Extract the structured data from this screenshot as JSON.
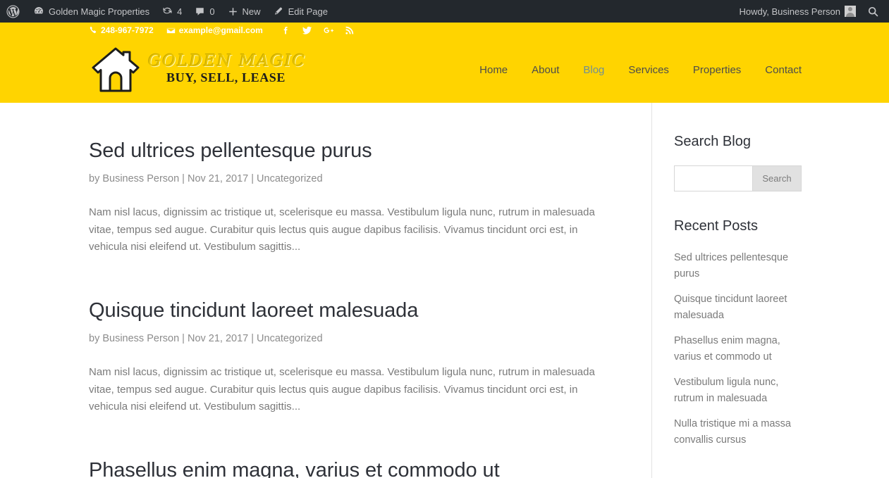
{
  "adminbar": {
    "logo_icon": "wordpress-icon",
    "site_name": "Golden Magic Properties",
    "site_icon": "dashboard-icon",
    "updates_icon": "updates-icon",
    "updates_count": "4",
    "comments_icon": "comment-icon",
    "comments_count": "0",
    "new_icon": "plus-icon",
    "new_label": "New",
    "edit_icon": "pencil-icon",
    "edit_label": "Edit Page",
    "howdy": "Howdy, Business Person",
    "avatar_icon": "avatar",
    "search_icon": "search-icon",
    "bg_color": "#23282d"
  },
  "header": {
    "bg_color": "#ffd400",
    "phone_icon": "phone-icon",
    "phone": "248-967-7972",
    "email_icon": "envelope-icon",
    "email": "example@gmail.com",
    "social": [
      {
        "name": "facebook-icon",
        "glyph": "f"
      },
      {
        "name": "twitter-icon",
        "glyph": ""
      },
      {
        "name": "googleplus-icon",
        "glyph": "G+"
      },
      {
        "name": "rss-icon",
        "glyph": ""
      }
    ],
    "logo": {
      "icon": "house-logo-icon",
      "name": "GOLDEN MAGIC",
      "tagline": "BUY, SELL, LEASE"
    },
    "nav": [
      {
        "label": "Home",
        "active": false
      },
      {
        "label": "About",
        "active": false
      },
      {
        "label": "Blog",
        "active": true
      },
      {
        "label": "Services",
        "active": false
      },
      {
        "label": "Properties",
        "active": false
      },
      {
        "label": "Contact",
        "active": false
      }
    ],
    "active_nav_color": "#6f8f96"
  },
  "main": {
    "posts": [
      {
        "title": "Sed ultrices pellentesque purus",
        "author_prefix": "by",
        "author": "Business Person",
        "date": "Nov 21, 2017",
        "category": "Uncategorized",
        "meta": "by Business Person | Nov 21, 2017 | Uncategorized",
        "excerpt": "Nam nisl lacus, dignissim ac tristique ut, scelerisque eu massa. Vestibulum ligula nunc, rutrum in malesuada vitae, tempus sed augue. Curabitur quis lectus quis augue dapibus facilisis. Vivamus tincidunt orci est, in vehicula nisi eleifend ut. Vestibulum sagittis..."
      },
      {
        "title": "Quisque tincidunt laoreet malesuada",
        "author_prefix": "by",
        "author": "Business Person",
        "date": "Nov 21, 2017",
        "category": "Uncategorized",
        "meta": "by Business Person | Nov 21, 2017 | Uncategorized",
        "excerpt": "Nam nisl lacus, dignissim ac tristique ut, scelerisque eu massa. Vestibulum ligula nunc, rutrum in malesuada vitae, tempus sed augue. Curabitur quis lectus quis augue dapibus facilisis. Vivamus tincidunt orci est, in vehicula nisi eleifend ut. Vestibulum sagittis..."
      },
      {
        "title": "Phasellus enim magna, varius et commodo ut",
        "meta": "",
        "excerpt": ""
      }
    ]
  },
  "sidebar": {
    "search_widget": {
      "title": "Search Blog",
      "input_value": "",
      "input_placeholder": "",
      "button_label": "Search"
    },
    "recent_widget": {
      "title": "Recent Posts",
      "items": [
        "Sed ultrices pellentesque purus",
        "Quisque tincidunt laoreet malesuada",
        "Phasellus enim magna, varius et commodo ut",
        "Vestibulum ligula nunc, rutrum in malesuada",
        "Nulla tristique mi a massa convallis cursus"
      ]
    }
  }
}
